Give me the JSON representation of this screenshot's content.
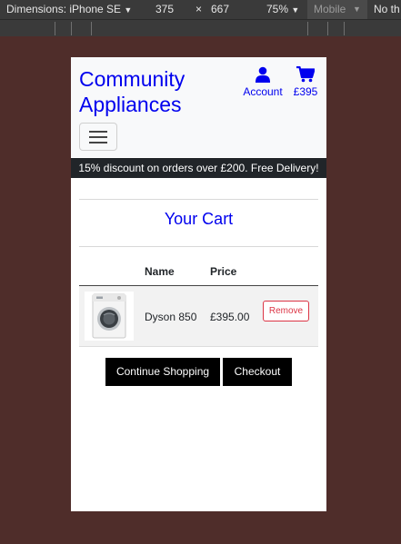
{
  "devtools": {
    "dimensions_label": "Dimensions: iPhone SE",
    "width": "375",
    "times": "×",
    "height": "667",
    "zoom": "75%",
    "device_type": "Mobile",
    "throttle": "No th"
  },
  "header": {
    "brand": "Community Appliances",
    "account_label": "Account",
    "cart_total": "£395"
  },
  "promo": {
    "text": "15% discount on orders over £200. Free Delivery!"
  },
  "cart": {
    "title": "Your Cart",
    "columns": [
      "Name",
      "Price"
    ],
    "items": [
      {
        "name": "Dyson 850",
        "price": "£395.00",
        "remove_label": "Remove"
      }
    ]
  },
  "actions": {
    "continue_label": "Continue Shopping",
    "checkout_label": "Checkout"
  },
  "colors": {
    "link": "#0000ee",
    "promo_bg": "#212529",
    "danger": "#dc3545",
    "page_bg": "#4f2d2a"
  },
  "icons": {
    "account": "person-icon",
    "cart": "shopping-cart-icon",
    "menu": "hamburger-icon"
  }
}
